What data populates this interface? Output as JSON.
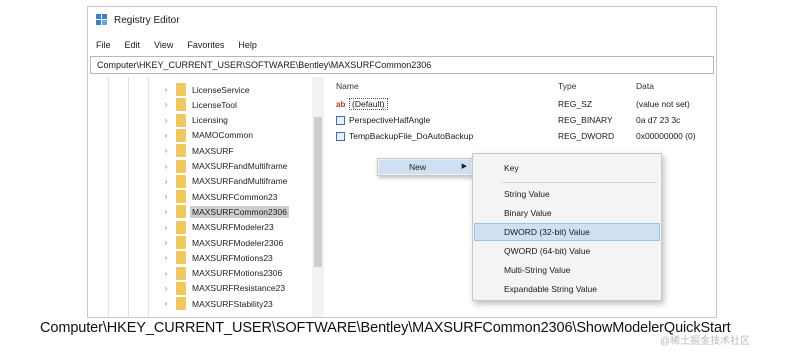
{
  "window": {
    "title": "Registry Editor",
    "menu": [
      "File",
      "Edit",
      "View",
      "Favorites",
      "Help"
    ],
    "address": "Computer\\HKEY_CURRENT_USER\\SOFTWARE\\Bentley\\MAXSURFCommon2306"
  },
  "tree": {
    "items": [
      {
        "label": "LicenseService"
      },
      {
        "label": "LicenseTool"
      },
      {
        "label": "Licensing"
      },
      {
        "label": "MAMOCommon"
      },
      {
        "label": "MAXSURF"
      },
      {
        "label": "MAXSURFandMultiframe"
      },
      {
        "label": "MAXSURFandMultiframe"
      },
      {
        "label": "MAXSURFCommon23"
      },
      {
        "label": "MAXSURFCommon2306",
        "selected": true
      },
      {
        "label": "MAXSURFModeler23"
      },
      {
        "label": "MAXSURFModeler2306"
      },
      {
        "label": "MAXSURFMotions23"
      },
      {
        "label": "MAXSURFMotions2306"
      },
      {
        "label": "MAXSURFResistance23"
      },
      {
        "label": "MAXSURFStability23"
      }
    ]
  },
  "values": {
    "headers": {
      "name": "Name",
      "type": "Type",
      "data": "Data"
    },
    "rows": [
      {
        "icon": "ab",
        "name": "(Default)",
        "type": "REG_SZ",
        "data": "(value not set)"
      },
      {
        "icon": "bin",
        "name": "PerspectiveHalfAngle",
        "type": "REG_BINARY",
        "data": "0a d7 23 3c"
      },
      {
        "icon": "bin",
        "name": "TempBackupFile_DoAutoBackup",
        "type": "REG_DWORD",
        "data": "0x00000000 (0)"
      }
    ]
  },
  "context_menu": {
    "new_label": "New",
    "submenu": [
      "Key",
      "String Value",
      "Binary Value",
      "DWORD (32-bit) Value",
      "QWORD (64-bit) Value",
      "Multi-String Value",
      "Expandable String Value"
    ],
    "highlighted": "DWORD (32-bit) Value"
  },
  "caption": "Computer\\HKEY_CURRENT_USER\\SOFTWARE\\Bentley\\MAXSURFCommon2306\\ShowModelerQuickStart",
  "watermark": "@稀土掘金技术社区",
  "colors": {
    "folder": "#f2c75b",
    "highlight": "#cfe0f3",
    "selected_tree": "#cfcfcf"
  }
}
